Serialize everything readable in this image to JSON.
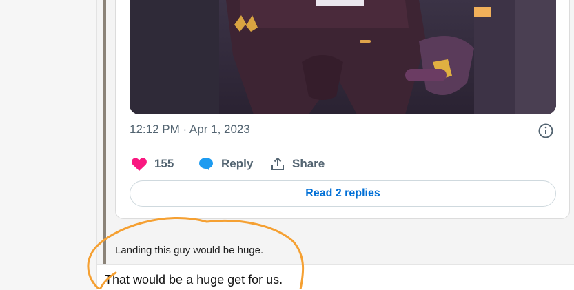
{
  "tweet": {
    "timestamp": "12:12 PM · Apr 1, 2023",
    "like_count": "155",
    "reply_label": "Reply",
    "share_label": "Share",
    "read_replies_label": "Read 2 replies"
  },
  "quote": {
    "text": "Landing this guy would be huge."
  },
  "post": {
    "text": "That would be a huge get for us."
  },
  "colors": {
    "like": "#f91880",
    "reply_icon": "#1d9bf0",
    "link": "#006fd6",
    "annotation": "#f5a032",
    "quote_bar": "#8b8378"
  },
  "icons": [
    "heart-icon",
    "reply-bubble-icon",
    "share-icon",
    "info-icon"
  ]
}
